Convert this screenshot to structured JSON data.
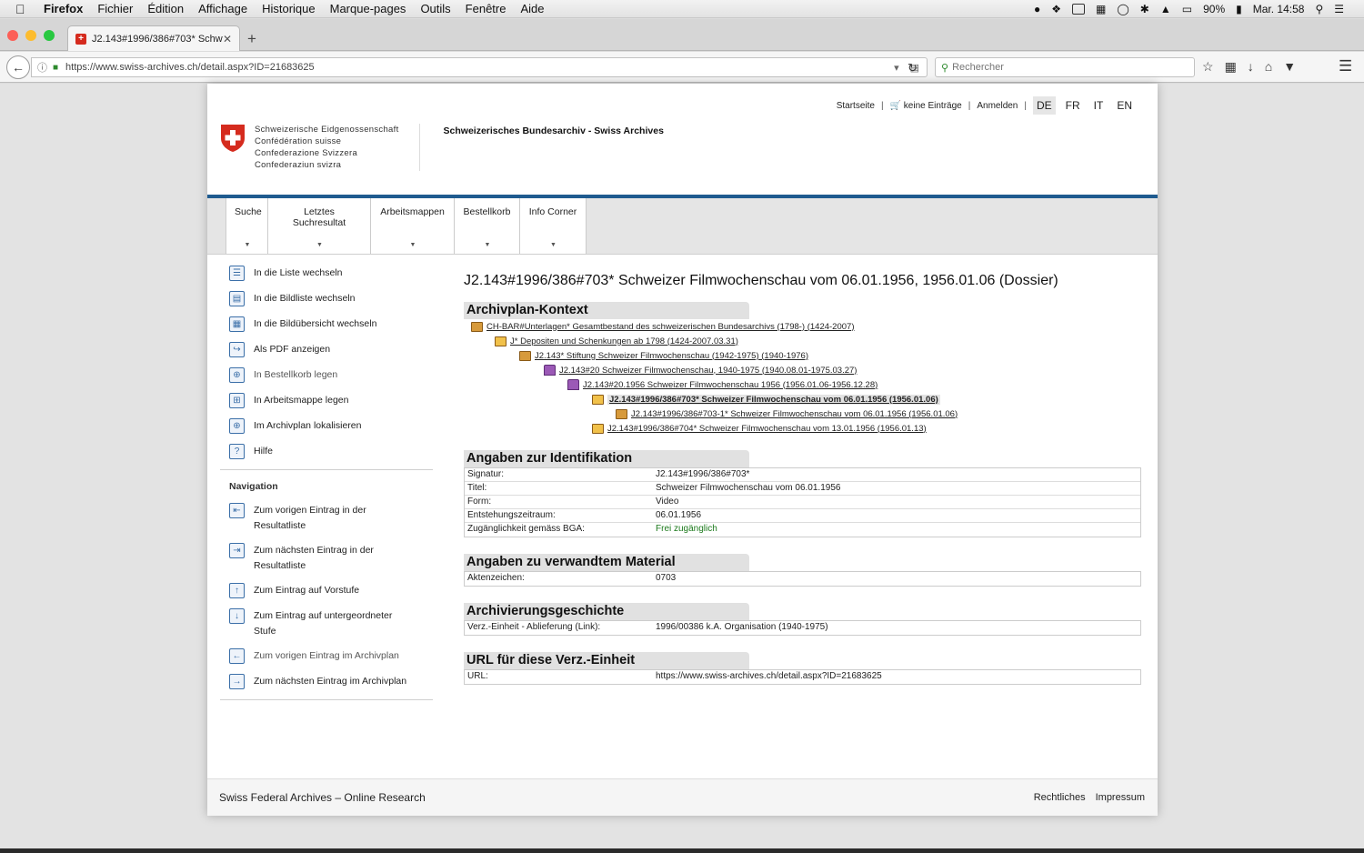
{
  "os_menu": {
    "app": "Firefox",
    "items": [
      "Fichier",
      "Édition",
      "Affichage",
      "Historique",
      "Marque-pages",
      "Outils",
      "Fenêtre",
      "Aide"
    ],
    "battery": "90%",
    "clock": "Mar. 14:58"
  },
  "browser": {
    "tab_title": "J2.143#1996/386#703* Schw",
    "url": "https://www.swiss-archives.ch/detail.aspx?ID=21683625",
    "search_placeholder": "Rechercher"
  },
  "site": {
    "topnav": {
      "home": "Startseite",
      "cart": "keine Einträge",
      "login": "Anmelden",
      "langs": [
        "DE",
        "FR",
        "IT",
        "EN"
      ]
    },
    "brand_lines": [
      "Schweizerische Eidgenossenschaft",
      "Confédération suisse",
      "Confederazione Svizzera",
      "Confederaziun svizra"
    ],
    "org": "Schweizerisches Bundesarchiv - Swiss Archives",
    "menu": [
      "Suche",
      "Letztes Suchresultat",
      "Arbeitsmappen",
      "Bestellkorb",
      "Info Corner"
    ],
    "actions": [
      "In die Liste wechseln",
      "In die Bildliste wechseln",
      "In die Bildübersicht wechseln",
      "Als PDF anzeigen",
      "In Bestellkorb legen",
      "In Arbeitsmappe legen",
      "Im Archivplan lokalisieren",
      "Hilfe"
    ],
    "navigation_heading": "Navigation",
    "nav": [
      "Zum vorigen Eintrag in der Resultatliste",
      "Zum nächsten Eintrag in der Resultatliste",
      "Zum Eintrag auf Vorstufe",
      "Zum Eintrag auf untergeordneter Stufe",
      "Zum vorigen Eintrag im Archivplan",
      "Zum nächsten Eintrag im Archivplan"
    ],
    "title": "J2.143#1996/386#703* Schweizer Filmwochenschau vom 06.01.1956, 1956.01.06 (Dossier)",
    "sections": {
      "context": "Archivplan-Kontext",
      "identification": "Angaben zur Identifikation",
      "related": "Angaben zu verwandtem Material",
      "history": "Archivierungsgeschichte",
      "url": "URL für diese Verz.-Einheit"
    },
    "tree": [
      "CH-BAR#Unterlagen* Gesamtbestand des schweizerischen Bundesarchivs (1798-) (1424-2007)",
      "J* Depositen und Schenkungen ab 1798 (1424-2007.03.31)",
      "J2.143* Stiftung Schweizer Filmwochenschau (1942-1975) (1940-1976)",
      "J2.143#20 Schweizer Filmwochenschau, 1940-1975 (1940.08.01-1975.03.27)",
      "J2.143#20.1956 Schweizer Filmwochenschau 1956 (1956.01.06-1956.12.28)",
      "J2.143#1996/386#703* Schweizer Filmwochenschau vom 06.01.1956 (1956.01.06)",
      "J2.143#1996/386#703-1* Schweizer Filmwochenschau vom 06.01.1956 (1956.01.06)",
      "J2.143#1996/386#704* Schweizer Filmwochenschau vom 13.01.1956 (1956.01.13)"
    ],
    "identification": [
      {
        "k": "Signatur:",
        "v": "J2.143#1996/386#703*"
      },
      {
        "k": "Titel:",
        "v": "Schweizer Filmwochenschau vom 06.01.1956"
      },
      {
        "k": "Form:",
        "v": "Video"
      },
      {
        "k": "Entstehungszeitraum:",
        "v": "06.01.1956"
      },
      {
        "k": "Zugänglichkeit gemäss BGA:",
        "v": "Frei zugänglich"
      }
    ],
    "related": [
      {
        "k": "Aktenzeichen:",
        "v": "0703"
      }
    ],
    "history": [
      {
        "k": "Verz.-Einheit - Ablieferung (Link):",
        "v": "1996/00386 k.A. Organisation (1940-1975)"
      }
    ],
    "url_rows": [
      {
        "k": "URL:",
        "v": "https://www.swiss-archives.ch/detail.aspx?ID=21683625"
      }
    ],
    "footer": {
      "left": "Swiss Federal Archives – Online Research",
      "legal": "Rechtliches",
      "imprint": "Impressum"
    }
  }
}
